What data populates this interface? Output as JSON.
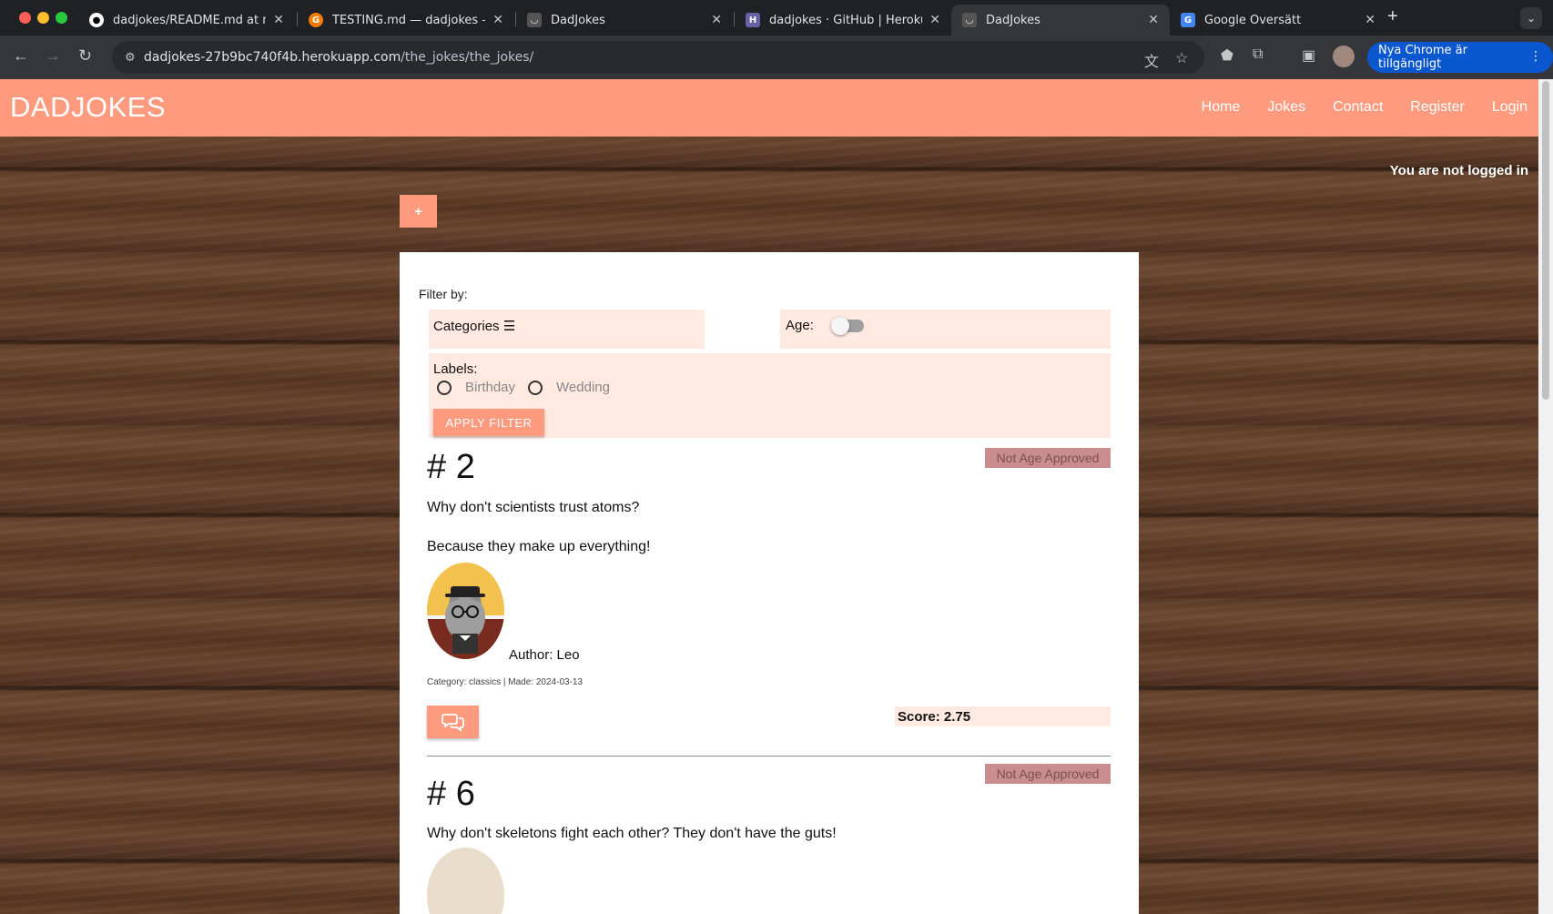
{
  "browser": {
    "tabs": [
      {
        "label": "dadjokes/README.md at main",
        "icon": "github-icon"
      },
      {
        "label": "TESTING.md — dadjokes — G",
        "icon": "gitbook-icon"
      },
      {
        "label": "DadJokes",
        "icon": "dadjokes-icon"
      },
      {
        "label": "dadjokes · GitHub | Heroku",
        "icon": "heroku-icon"
      },
      {
        "label": "DadJokes",
        "icon": "dadjokes-icon",
        "active": true
      },
      {
        "label": "Google Översätt",
        "icon": "google-translate-icon"
      }
    ],
    "url_host": "dadjokes-27b9bc740f4b.herokuapp.com",
    "url_path": "/the_jokes/the_jokes/",
    "update_label": "Nya Chrome är tillgängligt"
  },
  "site": {
    "brand": "DADJOKES",
    "nav": [
      "Home",
      "Jokes",
      "Contact",
      "Register",
      "Login"
    ],
    "login_status": "You are not logged in",
    "add_label": "+"
  },
  "filter": {
    "title": "Filter by:",
    "categories_label": "Categories",
    "age_label": "Age:",
    "labels_title": "Labels:",
    "label_options": [
      "Birthday",
      "Wedding"
    ],
    "apply_label": "APPLY FILTER"
  },
  "jokes": [
    {
      "number": "# 2",
      "badge": "Not Age Approved",
      "question": "Why don't scientists trust atoms?",
      "answer": "Because they make up everything!",
      "author": "Author: Leo",
      "meta": "Category: classics | Made: 2024-03-13",
      "score": "Score: 2.75"
    },
    {
      "number": "# 6",
      "badge": "Not Age Approved",
      "question": "Why don't skeletons fight each other? They don't have the guts!"
    }
  ],
  "colors": {
    "brand_salmon": "#fe9b7f",
    "filter_bg": "#ffe9e0",
    "badge_bg": "#c98d8d",
    "chrome_blue": "#0b57d0"
  }
}
